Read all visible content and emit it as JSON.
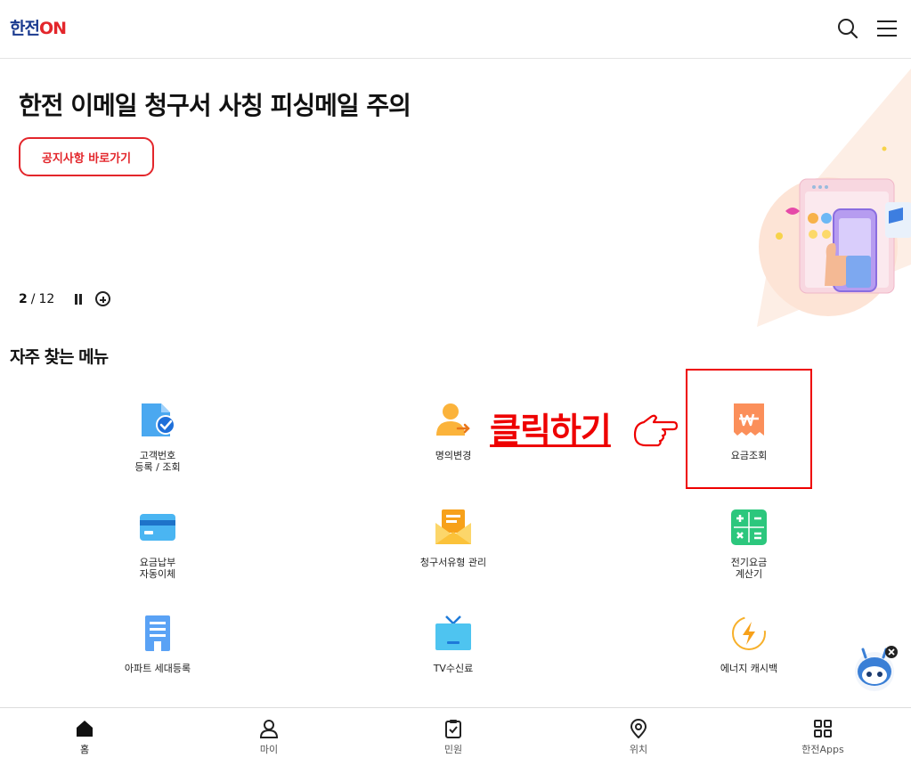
{
  "header": {
    "logo_text": "한전",
    "logo_on": "ON"
  },
  "banner": {
    "title": "한전 이메일 청구서 사칭 피싱메일 주의",
    "button_label": "공지사항 바로가기",
    "pager_current": "2",
    "pager_sep": " / ",
    "pager_total": "12"
  },
  "menu_section": {
    "title": "자주 찾는 메뉴",
    "items": [
      {
        "label": "고객번호\n등록 / 조회",
        "icon": "document-check-icon"
      },
      {
        "label": "명의변경",
        "icon": "person-transfer-icon"
      },
      {
        "label": "요금조회",
        "icon": "won-receipt-icon"
      },
      {
        "label": "요금납부\n자동이체",
        "icon": "credit-card-icon"
      },
      {
        "label": "청구서유형 관리",
        "icon": "envelope-icon"
      },
      {
        "label": "전기요금\n계산기",
        "icon": "calculator-icon"
      },
      {
        "label": "아파트 세대등록",
        "icon": "apartment-icon"
      },
      {
        "label": "TV수신료",
        "icon": "tv-icon"
      },
      {
        "label": "에너지 캐시백",
        "icon": "energy-cashback-icon"
      }
    ]
  },
  "annotation": {
    "text": "클릭하기"
  },
  "bottom_nav": [
    {
      "label": "홈",
      "icon": "home-icon"
    },
    {
      "label": "마이",
      "icon": "user-icon"
    },
    {
      "label": "민원",
      "icon": "clipboard-check-icon"
    },
    {
      "label": "위치",
      "icon": "location-pin-icon"
    },
    {
      "label": "한전Apps",
      "icon": "apps-grid-icon"
    }
  ],
  "colors": {
    "brand_blue": "#1a3a8f",
    "brand_red": "#e3262b",
    "annotation_red": "#ee0000"
  }
}
